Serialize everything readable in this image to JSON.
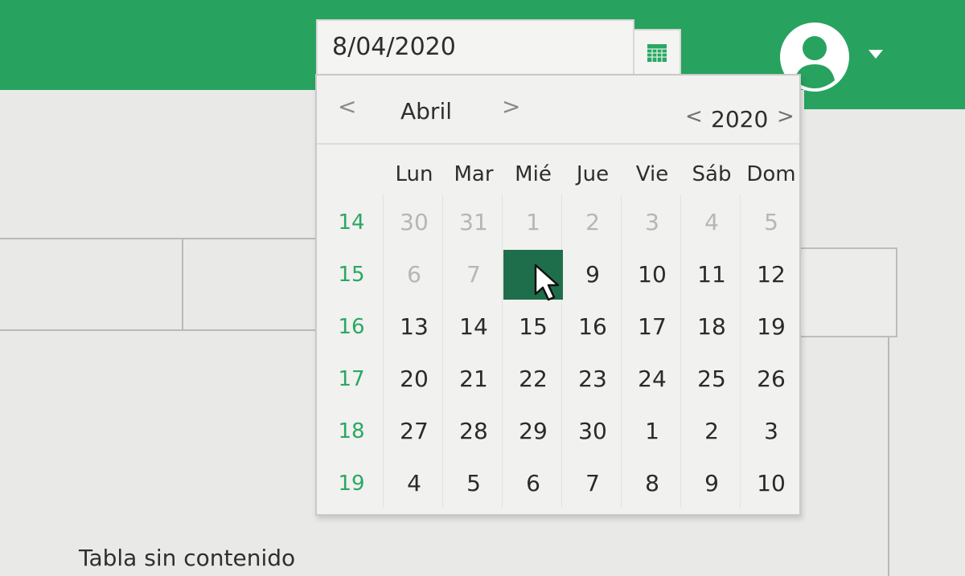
{
  "date_input": {
    "value": "8/04/2020"
  },
  "calendar": {
    "month": "Abril",
    "year": "2020",
    "prev_month_arrow": "<",
    "next_month_arrow": ">",
    "prev_year_arrow": "<",
    "next_year_arrow": ">",
    "weekdays": [
      "Lun",
      "Mar",
      "Mié",
      "Jue",
      "Vie",
      "Sáb",
      "Dom"
    ],
    "weeks": [
      {
        "number": "14",
        "days": [
          {
            "d": "30",
            "muted": true
          },
          {
            "d": "31",
            "muted": true
          },
          {
            "d": "1",
            "muted": true
          },
          {
            "d": "2",
            "muted": true
          },
          {
            "d": "3",
            "muted": true
          },
          {
            "d": "4",
            "muted": true
          },
          {
            "d": "5",
            "muted": true
          }
        ]
      },
      {
        "number": "15",
        "days": [
          {
            "d": "6",
            "muted": true
          },
          {
            "d": "7",
            "muted": true
          },
          {
            "d": "8",
            "selected": true
          },
          {
            "d": "9"
          },
          {
            "d": "10"
          },
          {
            "d": "11"
          },
          {
            "d": "12"
          }
        ]
      },
      {
        "number": "16",
        "days": [
          {
            "d": "13"
          },
          {
            "d": "14"
          },
          {
            "d": "15"
          },
          {
            "d": "16"
          },
          {
            "d": "17"
          },
          {
            "d": "18"
          },
          {
            "d": "19"
          }
        ]
      },
      {
        "number": "17",
        "days": [
          {
            "d": "20"
          },
          {
            "d": "21"
          },
          {
            "d": "22"
          },
          {
            "d": "23"
          },
          {
            "d": "24"
          },
          {
            "d": "25"
          },
          {
            "d": "26"
          }
        ]
      },
      {
        "number": "18",
        "days": [
          {
            "d": "27"
          },
          {
            "d": "28"
          },
          {
            "d": "29"
          },
          {
            "d": "30"
          },
          {
            "d": "1"
          },
          {
            "d": "2"
          },
          {
            "d": "3"
          }
        ]
      },
      {
        "number": "19",
        "days": [
          {
            "d": "4"
          },
          {
            "d": "5"
          },
          {
            "d": "6"
          },
          {
            "d": "7"
          },
          {
            "d": "8"
          },
          {
            "d": "9"
          },
          {
            "d": "10"
          }
        ]
      }
    ]
  },
  "table": {
    "empty_message": "Tabla sin contenido"
  },
  "colors": {
    "brand_green": "#27a35f",
    "week_number": "#2aa863",
    "selected_day": "#1f6e4b"
  },
  "icons": {
    "calendar": "calendar-icon",
    "user": "user-avatar-icon",
    "dropdown": "caret-down-icon"
  }
}
